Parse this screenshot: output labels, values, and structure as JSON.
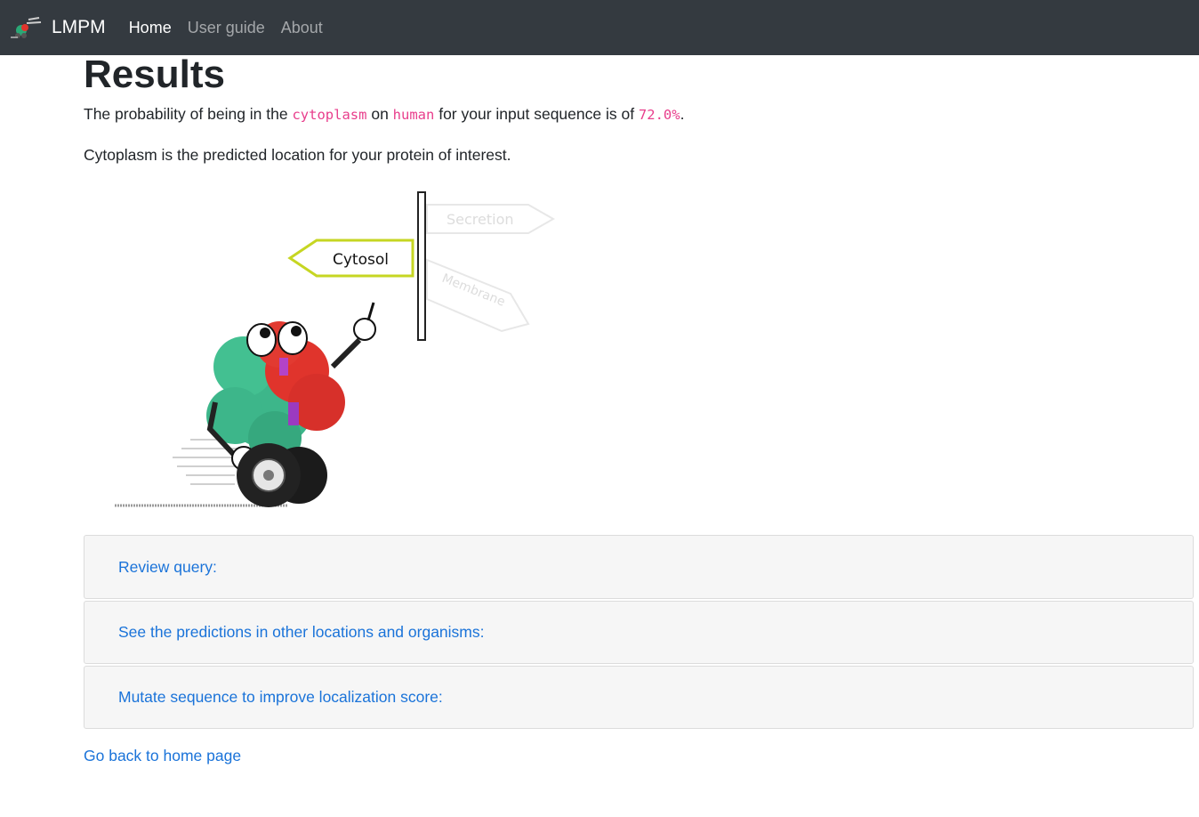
{
  "navbar": {
    "brand": "LMPM",
    "links": [
      {
        "label": "Home",
        "active": true
      },
      {
        "label": "User guide",
        "active": false
      },
      {
        "label": "About",
        "active": false
      }
    ]
  },
  "results": {
    "title": "Results",
    "sentence_prefix": "The probability of being in the ",
    "location": "cytoplasm",
    "sentence_on": " on ",
    "organism": "human",
    "sentence_middle": " for your input sequence is of ",
    "probability": "72.0%",
    "sentence_end": ".",
    "prediction_text": "Cytoplasm is the predicted location for your protein of interest."
  },
  "illustration": {
    "signs": [
      "Cytosol",
      "Secretion",
      "Membrane"
    ]
  },
  "accordion": [
    {
      "label": "Review query:"
    },
    {
      "label": "See the predictions in other locations and organisms:"
    },
    {
      "label": "Mutate sequence to improve localization score:"
    }
  ],
  "back_link": "Go back to home page",
  "colors": {
    "navbar": "#343a40",
    "link": "#1a73d9",
    "code": "#e83e8c",
    "card_bg": "#f6f6f6"
  }
}
